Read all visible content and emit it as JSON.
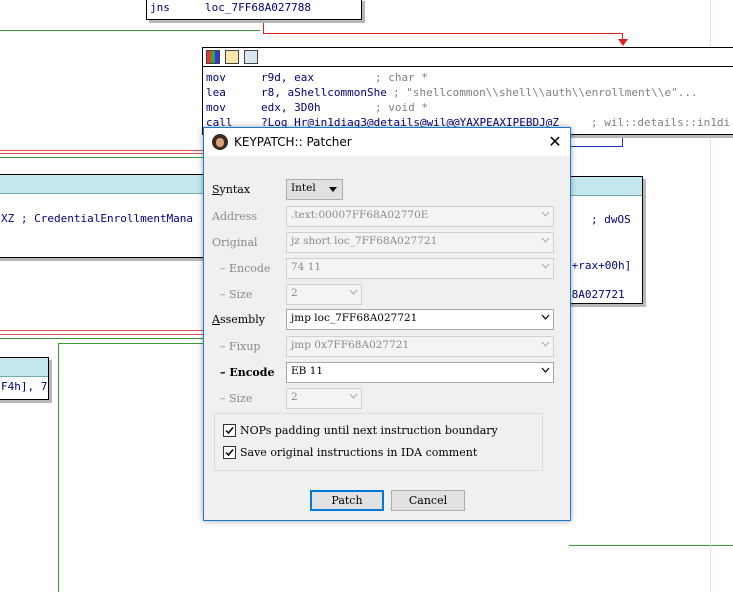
{
  "graph": {
    "top_node": {
      "mnemonic": "jns",
      "operand": "loc_7FF68A027788"
    },
    "main_node": {
      "toolbar_icons": [
        "palette-icon",
        "edit-icon",
        "graph-icon"
      ],
      "lines": [
        {
          "mnemonic": "mov",
          "operands": "r9d, eax",
          "comment": "; char *"
        },
        {
          "mnemonic": "lea",
          "operands": "r8, aShellcommonShe",
          "comment": "; \"shellcommon\\\\shell\\\\auth\\\\enrollment\\\\e\"..."
        },
        {
          "mnemonic": "mov",
          "operands": "edx, 3D0h",
          "comment": "; void *"
        },
        {
          "mnemonic": "call",
          "operands": "?Log_Hr@in1diag3@details@wil@@YAXPEAXIPEBDJ@Z",
          "comment": "; wil::details::in1di"
        }
      ]
    },
    "left_node": {
      "text": "XZ ; CredentialEnrollmentMana"
    },
    "right_node": {
      "comment": "; dwOS",
      "operand": "x+rax+00h]",
      "loc": "68A027721"
    },
    "bottom_left_node": {
      "text": "F4h], 7"
    }
  },
  "dialog": {
    "title": "KEYPATCH:: Patcher",
    "close_glyph": "✕",
    "syntax": {
      "label": "Syntax",
      "value": "Intel"
    },
    "address": {
      "label": "Address",
      "value": ".text:00007FF68A02770E"
    },
    "original": {
      "label": "Original",
      "value": "jz short loc_7FF68A027721"
    },
    "original_encode": {
      "label": "–   Encode",
      "value": "74 11"
    },
    "original_size": {
      "label": "–   Size",
      "value": "2"
    },
    "assembly": {
      "label": "Assembly",
      "value": "jmp loc_7FF68A027721"
    },
    "fixup": {
      "label": "–   Fixup",
      "value": "jmp 0x7FF68A027721"
    },
    "encode": {
      "label": "–   Encode",
      "value": "EB 11"
    },
    "size": {
      "label": "–   Size",
      "value": "2"
    },
    "nop_padding": {
      "label": "NOPs padding until next instruction boundary",
      "checked": true
    },
    "save_original": {
      "label": "Save original instructions in IDA comment",
      "checked": true
    },
    "patch_button": "Patch",
    "cancel_button": "Cancel"
  }
}
